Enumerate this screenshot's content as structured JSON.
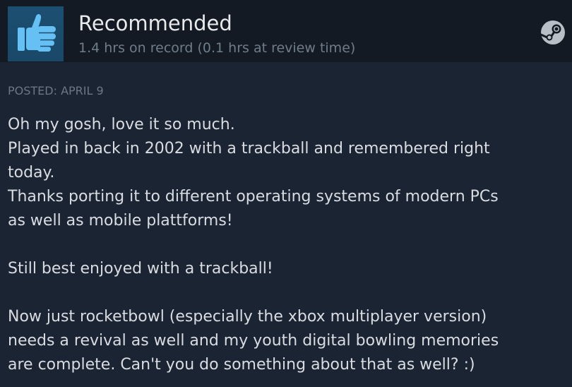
{
  "review": {
    "verdict": "Recommended",
    "hours": "1.4 hrs on record (0.1 hrs at review time)",
    "posted": "POSTED: APRIL 9",
    "icons": {
      "verdict_icon": "thumbs-up-icon",
      "platform_icon": "steam-icon"
    },
    "body": {
      "l1": "Oh my gosh, love it so much.",
      "l2": "Played in back in 2002 with a trackball and remembered right",
      "l3": "today.",
      "l4": "Thanks porting it to different operating systems of modern PCs",
      "l5": "as well as mobile plattforms!",
      "l6": "Still best enjoyed with a trackball!",
      "l7": "Now just rocketbowl (especially the xbox multiplayer version)",
      "l8": "needs a revival as well and my youth digital bowling memories",
      "l9": "are complete. Can't you do something about that as well? :)"
    }
  },
  "colors": {
    "background": "#1b2433",
    "header_background": "#141a24",
    "icon_box": "#1b4f72",
    "thumb": "#66c0f4",
    "title_text": "#e8eaec",
    "muted_text": "#6f7d8b",
    "body_text": "#d9dde2"
  }
}
